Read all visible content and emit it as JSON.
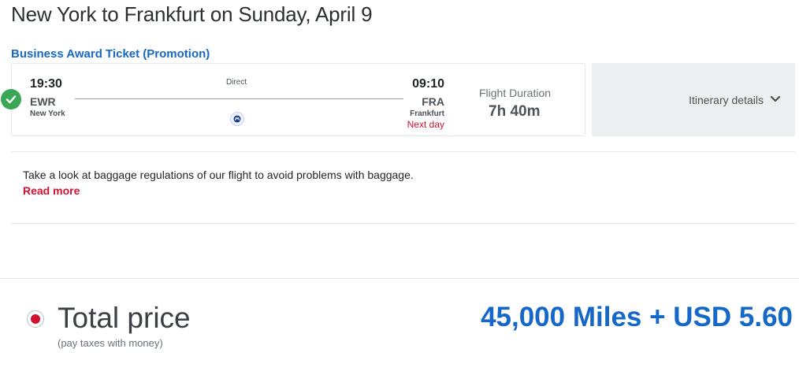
{
  "header": {
    "title": "New York to Frankfurt on Sunday, April 9"
  },
  "ticket": {
    "type": "Business Award Ticket (Promotion)"
  },
  "flight": {
    "departure": {
      "time": "19:30",
      "code": "EWR",
      "city": "New York"
    },
    "arrival": {
      "time": "09:10",
      "code": "FRA",
      "city": "Frankfurt",
      "day_note": "Next day"
    },
    "stops_label": "Direct",
    "airline_icon": "united-airlines-logo-icon",
    "duration_label": "Flight Duration",
    "duration_value": "7h 40m",
    "selected_icon": "check-circle-icon"
  },
  "itinerary": {
    "label": "Itinerary details",
    "icon": "chevron-down-icon"
  },
  "baggage": {
    "text": "Take a look at baggage regulations of our flight to avoid problems with baggage.",
    "link": "Read more"
  },
  "price": {
    "label": "Total price",
    "sublabel": "(pay taxes with money)",
    "value": "45,000 Miles + USD 5.60"
  },
  "colors": {
    "accent_blue": "#1668c7",
    "accent_red": "#d1112f",
    "success_green": "#3aa757"
  }
}
